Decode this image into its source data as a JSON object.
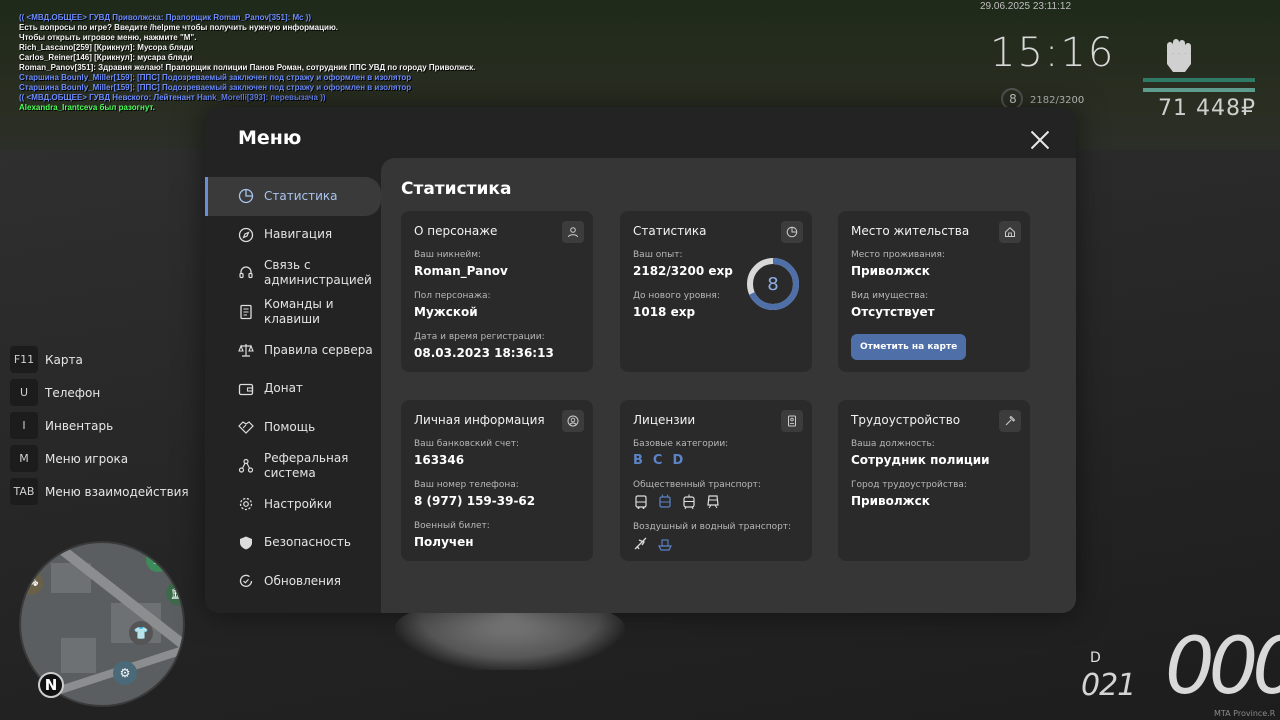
{
  "chat": [
    {
      "text": "(( <МВД.ОБЩЕЕ> ГУВД Приволжска: Прапорщик Roman_Panov[351]: Мс ))",
      "color": "blue"
    },
    {
      "text": "Есть вопросы по игре? Введите /helpme чтобы получить нужную информацию.",
      "color": "white"
    },
    {
      "text": "Чтобы открыть игровое меню, нажмите \"M\".",
      "color": "white"
    },
    {
      "text": "Rich_Lascano[259] [Крикнул]: Мусора бляди",
      "color": "white"
    },
    {
      "text": "Carlos_Reiner[146] [Крикнул]: мусара бляди",
      "color": "white"
    },
    {
      "text": "Roman_Panov[351]: Здравия желаю! Прапорщик полиции Панов Роман, сотрудник ППС УВД по городу Приволжск.",
      "color": "white"
    },
    {
      "text": "Старшина Bounly_Miller[159]: [ППС] Подозреваемый заключен под стражу и оформлен в изолятор",
      "color": "blue"
    },
    {
      "text": "Старшина Bounly_Miller[159]: [ППС] Подозреваемый заключен под стражу и оформлен в изолятор",
      "color": "blue"
    },
    {
      "text": "(( <МВД.ОБЩЕЕ> ГУВД Невского: Лейтенант Hank_Morelli[393]: перевызача ))",
      "color": "blue"
    },
    {
      "text": "Alexandra_Irantceva был разогнут.",
      "color": "green"
    }
  ],
  "hud": {
    "datetime": "29.06.2025 23:11:12",
    "time": "15:16",
    "level": "8",
    "exp": "2182/3200",
    "money": "71 448₽",
    "health_fraction": 1.0,
    "armor_fraction": 1.0
  },
  "keybinds": [
    {
      "key": "F11",
      "label": "Карта"
    },
    {
      "key": "U",
      "label": "Телефон"
    },
    {
      "key": "I",
      "label": "Инвентарь"
    },
    {
      "key": "M",
      "label": "Меню игрока"
    },
    {
      "key": "TAB",
      "label": "Меню взаимодействия"
    }
  ],
  "minimap": {
    "north": "N"
  },
  "speedometer": {
    "gear": "D",
    "fuel": "021",
    "speed": "000"
  },
  "watermark": "MTA Province.R",
  "menu": {
    "title": "Меню",
    "sidebar": [
      {
        "label": "Статистика",
        "icon": "pie-chart-icon",
        "active": true
      },
      {
        "label": "Навигация",
        "icon": "compass-icon"
      },
      {
        "label": "Связь с администрацией",
        "icon": "headset-icon"
      },
      {
        "label": "Команды и клавиши",
        "icon": "document-icon"
      },
      {
        "label": "Правила сервера",
        "icon": "scales-icon"
      },
      {
        "label": "Донат",
        "icon": "wallet-icon"
      },
      {
        "label": "Помощь",
        "icon": "handshake-icon"
      },
      {
        "label": "Реферальная система",
        "icon": "network-icon"
      },
      {
        "label": "Настройки",
        "icon": "gear-icon"
      },
      {
        "label": "Безопасность",
        "icon": "shield-icon"
      },
      {
        "label": "Обновления",
        "icon": "refresh-check-icon"
      }
    ],
    "content_title": "Статистика",
    "cards": {
      "character": {
        "title": "О персонаже",
        "nickname_label": "Ваш никнейм:",
        "nickname": "Roman_Panov",
        "gender_label": "Пол персонажа:",
        "gender": "Мужской",
        "reg_label": "Дата и время регистрации:",
        "reg": "08.03.2023 18:36:13"
      },
      "stats": {
        "title": "Статистика",
        "exp_label": "Ваш опыт:",
        "exp": "2182/3200 exp",
        "next_label": "До нового уровня:",
        "next": "1018 exp",
        "level": "8",
        "progress": 0.682
      },
      "residence": {
        "title": "Место жительства",
        "place_label": "Место проживания:",
        "place": "Приволжск",
        "property_label": "Вид имущества:",
        "property": "Отсутствует",
        "map_button": "Отметить на карте"
      },
      "personal": {
        "title": "Личная информация",
        "bank_label": "Ваш банковский счет:",
        "bank": "163346",
        "phone_label": "Ваш номер телефона:",
        "phone": "8 (977) 159-39-62",
        "military_label": "Военный билет:",
        "military": "Получен"
      },
      "licenses": {
        "title": "Лицензии",
        "base_label": "Базовые категории:",
        "categories": [
          "B",
          "C",
          "D"
        ],
        "public_label": "Общественный транспорт:",
        "air_label": "Воздушный и водный транспорт:"
      },
      "job": {
        "title": "Трудоустройство",
        "position_label": "Ваша должность:",
        "position": "Сотрудник полиции",
        "city_label": "Город трудоустройства:",
        "city": "Приволжск"
      }
    }
  }
}
